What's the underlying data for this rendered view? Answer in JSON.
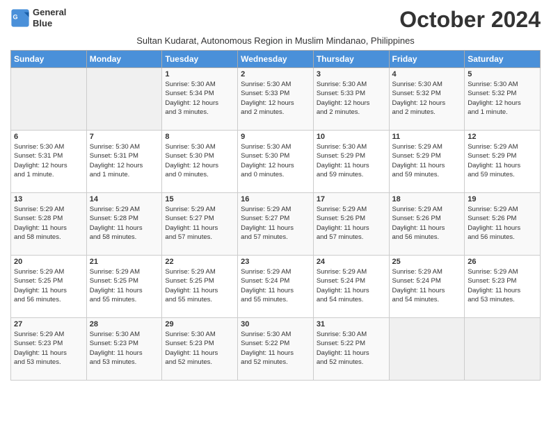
{
  "logo": {
    "line1": "General",
    "line2": "Blue"
  },
  "title": "October 2024",
  "subtitle": "Sultan Kudarat, Autonomous Region in Muslim Mindanao, Philippines",
  "headers": [
    "Sunday",
    "Monday",
    "Tuesday",
    "Wednesday",
    "Thursday",
    "Friday",
    "Saturday"
  ],
  "weeks": [
    [
      {
        "num": "",
        "info": ""
      },
      {
        "num": "",
        "info": ""
      },
      {
        "num": "1",
        "info": "Sunrise: 5:30 AM\nSunset: 5:34 PM\nDaylight: 12 hours\nand 3 minutes."
      },
      {
        "num": "2",
        "info": "Sunrise: 5:30 AM\nSunset: 5:33 PM\nDaylight: 12 hours\nand 2 minutes."
      },
      {
        "num": "3",
        "info": "Sunrise: 5:30 AM\nSunset: 5:33 PM\nDaylight: 12 hours\nand 2 minutes."
      },
      {
        "num": "4",
        "info": "Sunrise: 5:30 AM\nSunset: 5:32 PM\nDaylight: 12 hours\nand 2 minutes."
      },
      {
        "num": "5",
        "info": "Sunrise: 5:30 AM\nSunset: 5:32 PM\nDaylight: 12 hours\nand 1 minute."
      }
    ],
    [
      {
        "num": "6",
        "info": "Sunrise: 5:30 AM\nSunset: 5:31 PM\nDaylight: 12 hours\nand 1 minute."
      },
      {
        "num": "7",
        "info": "Sunrise: 5:30 AM\nSunset: 5:31 PM\nDaylight: 12 hours\nand 1 minute."
      },
      {
        "num": "8",
        "info": "Sunrise: 5:30 AM\nSunset: 5:30 PM\nDaylight: 12 hours\nand 0 minutes."
      },
      {
        "num": "9",
        "info": "Sunrise: 5:30 AM\nSunset: 5:30 PM\nDaylight: 12 hours\nand 0 minutes."
      },
      {
        "num": "10",
        "info": "Sunrise: 5:30 AM\nSunset: 5:29 PM\nDaylight: 11 hours\nand 59 minutes."
      },
      {
        "num": "11",
        "info": "Sunrise: 5:29 AM\nSunset: 5:29 PM\nDaylight: 11 hours\nand 59 minutes."
      },
      {
        "num": "12",
        "info": "Sunrise: 5:29 AM\nSunset: 5:29 PM\nDaylight: 11 hours\nand 59 minutes."
      }
    ],
    [
      {
        "num": "13",
        "info": "Sunrise: 5:29 AM\nSunset: 5:28 PM\nDaylight: 11 hours\nand 58 minutes."
      },
      {
        "num": "14",
        "info": "Sunrise: 5:29 AM\nSunset: 5:28 PM\nDaylight: 11 hours\nand 58 minutes."
      },
      {
        "num": "15",
        "info": "Sunrise: 5:29 AM\nSunset: 5:27 PM\nDaylight: 11 hours\nand 57 minutes."
      },
      {
        "num": "16",
        "info": "Sunrise: 5:29 AM\nSunset: 5:27 PM\nDaylight: 11 hours\nand 57 minutes."
      },
      {
        "num": "17",
        "info": "Sunrise: 5:29 AM\nSunset: 5:26 PM\nDaylight: 11 hours\nand 57 minutes."
      },
      {
        "num": "18",
        "info": "Sunrise: 5:29 AM\nSunset: 5:26 PM\nDaylight: 11 hours\nand 56 minutes."
      },
      {
        "num": "19",
        "info": "Sunrise: 5:29 AM\nSunset: 5:26 PM\nDaylight: 11 hours\nand 56 minutes."
      }
    ],
    [
      {
        "num": "20",
        "info": "Sunrise: 5:29 AM\nSunset: 5:25 PM\nDaylight: 11 hours\nand 56 minutes."
      },
      {
        "num": "21",
        "info": "Sunrise: 5:29 AM\nSunset: 5:25 PM\nDaylight: 11 hours\nand 55 minutes."
      },
      {
        "num": "22",
        "info": "Sunrise: 5:29 AM\nSunset: 5:25 PM\nDaylight: 11 hours\nand 55 minutes."
      },
      {
        "num": "23",
        "info": "Sunrise: 5:29 AM\nSunset: 5:24 PM\nDaylight: 11 hours\nand 55 minutes."
      },
      {
        "num": "24",
        "info": "Sunrise: 5:29 AM\nSunset: 5:24 PM\nDaylight: 11 hours\nand 54 minutes."
      },
      {
        "num": "25",
        "info": "Sunrise: 5:29 AM\nSunset: 5:24 PM\nDaylight: 11 hours\nand 54 minutes."
      },
      {
        "num": "26",
        "info": "Sunrise: 5:29 AM\nSunset: 5:23 PM\nDaylight: 11 hours\nand 53 minutes."
      }
    ],
    [
      {
        "num": "27",
        "info": "Sunrise: 5:29 AM\nSunset: 5:23 PM\nDaylight: 11 hours\nand 53 minutes."
      },
      {
        "num": "28",
        "info": "Sunrise: 5:30 AM\nSunset: 5:23 PM\nDaylight: 11 hours\nand 53 minutes."
      },
      {
        "num": "29",
        "info": "Sunrise: 5:30 AM\nSunset: 5:23 PM\nDaylight: 11 hours\nand 52 minutes."
      },
      {
        "num": "30",
        "info": "Sunrise: 5:30 AM\nSunset: 5:22 PM\nDaylight: 11 hours\nand 52 minutes."
      },
      {
        "num": "31",
        "info": "Sunrise: 5:30 AM\nSunset: 5:22 PM\nDaylight: 11 hours\nand 52 minutes."
      },
      {
        "num": "",
        "info": ""
      },
      {
        "num": "",
        "info": ""
      }
    ]
  ]
}
